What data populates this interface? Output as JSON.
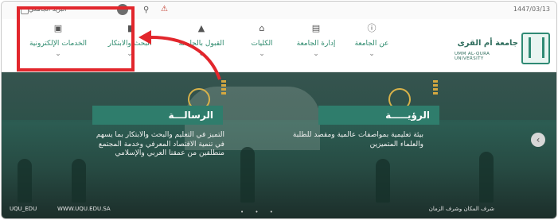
{
  "topbar": {
    "date": "1447/03/13",
    "user_email": "البريد الجامعي",
    "separator": "•••"
  },
  "nav": {
    "items": [
      {
        "label": "الخدمات الإلكترونية",
        "icon": "laptop-icon"
      },
      {
        "label": "البحث والابتكار",
        "icon": "book-icon"
      },
      {
        "label": "القبول بالجامعة",
        "icon": "graduation-cap-icon"
      },
      {
        "label": "الكليات",
        "icon": "building-icon"
      },
      {
        "label": "إدارة الجامعة",
        "icon": "document-icon"
      },
      {
        "label": "عن الجامعة",
        "icon": "info-icon"
      }
    ],
    "chevron": "⌄"
  },
  "logo": {
    "arabic_name": "جامعة أم القرى",
    "english_name": "UMM AL-QURA UNIVERSITY"
  },
  "hero": {
    "vision": {
      "title": "الرؤيـــــة",
      "text": "بيئة تعليمية بمواصفات عالمية ومقصد للطلبة والعلماء المتميزين"
    },
    "mission": {
      "title": "الرسالـــة",
      "text": "التميز في التعليم والبحث والابتكار بما يسهم في تنمية الاقتصاد المعرفي وخدمة المجتمع منطلقين من عمقنا العربي والإسلامي"
    },
    "next_arrow": "‹",
    "footer_right": "شرف المكان وشرف الزمان",
    "social_1": "UQU_EDU",
    "social_2": "WWW.UQU.EDU.SA",
    "slider_dots": "• • •"
  },
  "colors": {
    "accent_green": "#2f8a74",
    "highlight_red": "#e2262c"
  }
}
